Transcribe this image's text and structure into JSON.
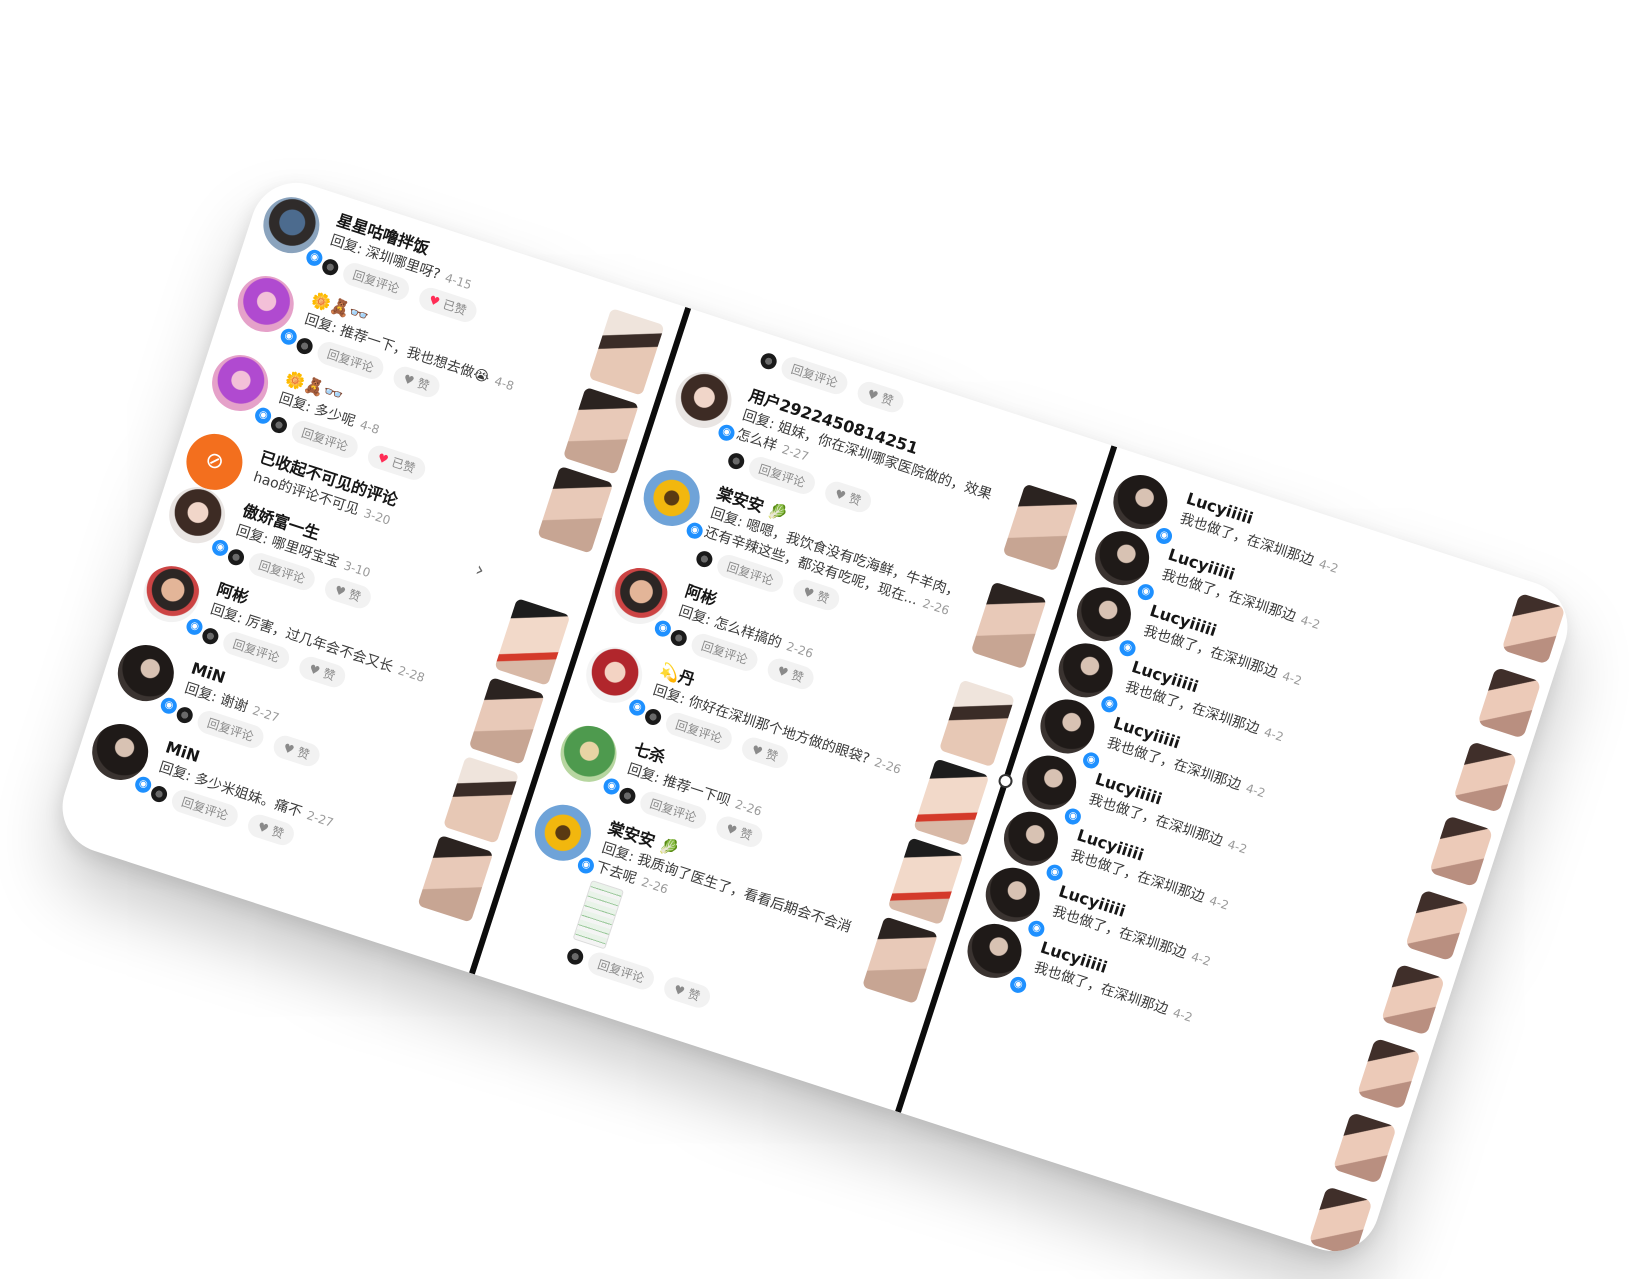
{
  "ui": {
    "reply_button": "回复评论",
    "like_label": "赞",
    "liked_label": "已赞",
    "reply_prefix": "回复: "
  },
  "column1": {
    "comments": [
      {
        "name": "星星咕噜拌饭",
        "text": "回复: 深圳哪里呀?",
        "date": "4-15",
        "liked": true,
        "like_label": "已赞"
      },
      {
        "name": "🌼🧸👓",
        "text": "回复: 推荐一下，我也想去做😭",
        "date": "4-8",
        "liked": false,
        "like_label": "赞"
      },
      {
        "name": "🌼🧸👓",
        "text": "回复: 多少呢",
        "date": "4-8",
        "liked": true,
        "like_label": "已赞"
      }
    ],
    "hidden_notice": {
      "title": "已收起不可见的评论",
      "text": "hao的评论不可见",
      "date": "3-20"
    },
    "comments2": [
      {
        "name": "傲娇富一生",
        "text": "回复: 哪里呀宝宝",
        "date": "3-10",
        "like_label": "赞"
      },
      {
        "name": "阿彬",
        "text": "回复: 厉害，过几年会不会又长",
        "date": "2-28",
        "like_label": "赞"
      },
      {
        "name": "MiN",
        "text": "回复: 谢谢",
        "date": "2-27",
        "like_label": "赞"
      },
      {
        "name": "MiN",
        "text": "回复: 多少米姐妹。痛不",
        "date": "2-27",
        "like_label": "赞"
      }
    ]
  },
  "column2": {
    "top_actions": {
      "reply": "回复评论",
      "like": "赞"
    },
    "comments": [
      {
        "name": "用户2922450814251",
        "text": "回复: 姐妹，你在深圳哪家医院做的，效果怎么样",
        "date": "2-27",
        "like_label": "赞"
      },
      {
        "name": "棠安安 🥬",
        "text": "回复: 嗯嗯，我饮食没有吃海鲜，牛羊肉，还有辛辣这些，都没有吃呢，现在...",
        "date": "2-26",
        "like_label": "赞"
      },
      {
        "name": "阿彬",
        "text": "回复: 怎么样搞的",
        "date": "2-26",
        "like_label": "赞"
      },
      {
        "name": "💫丹",
        "text": "回复: 你好在深圳那个地方做的眼袋?",
        "date": "2-26",
        "like_label": "赞"
      },
      {
        "name": "七杀",
        "text": "回复: 推荐一下呗",
        "date": "2-26",
        "like_label": "赞"
      },
      {
        "name": "棠安安 🥬",
        "text": "回复: 我质询了医生了，看看后期会不会消下去呢",
        "date": "2-26",
        "like_label": "赞"
      }
    ]
  },
  "column3": {
    "comments": [
      {
        "name": "Lucyiiiii",
        "text": "我也做了，在深圳那边",
        "date": "4-2"
      },
      {
        "name": "Lucyiiiii",
        "text": "我也做了，在深圳那边",
        "date": "4-2"
      },
      {
        "name": "Lucyiiiii",
        "text": "我也做了，在深圳那边",
        "date": "4-2"
      },
      {
        "name": "Lucyiiiii",
        "text": "我也做了，在深圳那边",
        "date": "4-2"
      },
      {
        "name": "Lucyiiiii",
        "text": "我也做了，在深圳那边",
        "date": "4-2"
      },
      {
        "name": "Lucyiiiii",
        "text": "我也做了，在深圳那边",
        "date": "4-2"
      },
      {
        "name": "Lucyiiiii",
        "text": "我也做了，在深圳那边",
        "date": "4-2"
      },
      {
        "name": "Lucyiiiii",
        "text": "我也做了，在深圳那边",
        "date": "4-2"
      },
      {
        "name": "Lucyiiiii",
        "text": "我也做了，在深圳那边",
        "date": "4-2"
      }
    ]
  },
  "colors": {
    "like_active": "#ff2c55",
    "verified_badge": "#1e90ff",
    "hidden_icon_bg": "#f36f1e",
    "divider": "#0c0c0c"
  },
  "icons": {
    "verified": "verified-badge-icon",
    "heart": "heart-icon",
    "eye_off": "eye-off-icon",
    "chevron": "chevron-right-icon"
  }
}
